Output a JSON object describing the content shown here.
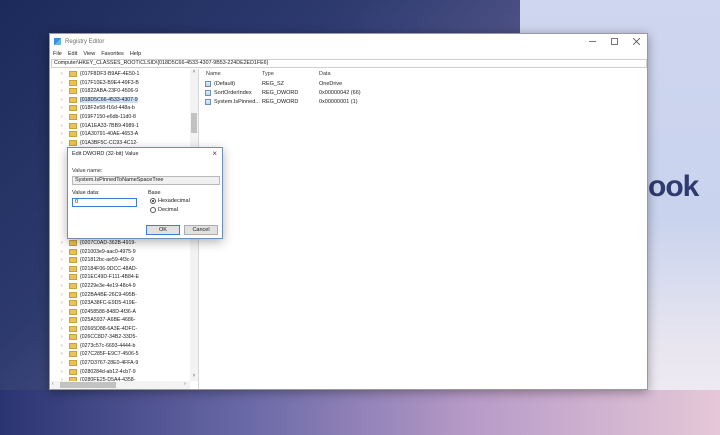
{
  "wallpaper": {
    "brand_text": "ook"
  },
  "window": {
    "title": "Registry Editor",
    "menu": [
      "File",
      "Edit",
      "View",
      "Favorites",
      "Help"
    ],
    "address": "Computer\\HKEY_CLASSES_ROOT\\CLSID\\{018D5C66-4533-4307-9B53-224DE2ED1FE6}"
  },
  "tree": {
    "items": [
      "{017F8DF3-B9AF-4E50-1",
      "{017F10E3-B9E4-49F3-B",
      "{01822ABA-23F0-4506-9",
      "{018D5C66-4533-4307-9",
      "{018F2e58-f16d-448a-b",
      "{019F7150-e6db-11d0-8",
      "{01A1EA33-7BB9-4989-1",
      "{01A30791-40AE-4653-A",
      "{01A3BF5C-CC93-4C12-",
      "{0207C0AD-362B-4919-",
      "{021003e9-aac0-4975-9",
      "{021812bc-ae59-4f3c-9",
      "{02184F06-9DCC-48AD-",
      "{021EC49D-F111-4B84-E",
      "{02229e3e-4e19-48c4-9",
      "{022BA4BE-26C9-495B-",
      "{023A38FC-E9D5-419E-",
      "{02458588-848D-4f36-A",
      "{025A5937-A6BE-4686-",
      "{02665D88-6A3E-4DFC-",
      "{026CC8D7-34B2-33D5-",
      "{0273c57c-6693-4444-b",
      "{027C285F-E9C7-4506-5",
      "{027D3767-28E0-4FFA-9",
      "{0280284d-ab12-4cb7-9",
      "{0280FE25-D5A4-4358-"
    ]
  },
  "values": {
    "headers": [
      "Name",
      "Type",
      "Data"
    ],
    "rows": [
      {
        "name": "(Default)",
        "type": "REG_SZ",
        "data": "OneDrive"
      },
      {
        "name": "SortOrderIndex",
        "type": "REG_DWORD",
        "data": "0x00000042 (66)"
      },
      {
        "name": "System.IsPinned...",
        "type": "REG_DWORD",
        "data": "0x00000001 (1)"
      }
    ]
  },
  "dialog": {
    "title": "Edit DWORD (32-bit) Value",
    "value_name_label": "Value name:",
    "value_name": "System.IsPinnedToNameSpaceTree",
    "value_data_label": "Value data:",
    "value_data": "0",
    "base_label": "Base",
    "hex_label": "Hexadecimal",
    "dec_label": "Decimal",
    "ok_label": "OK",
    "cancel_label": "Cancel",
    "base_selected": "Hexadecimal"
  }
}
